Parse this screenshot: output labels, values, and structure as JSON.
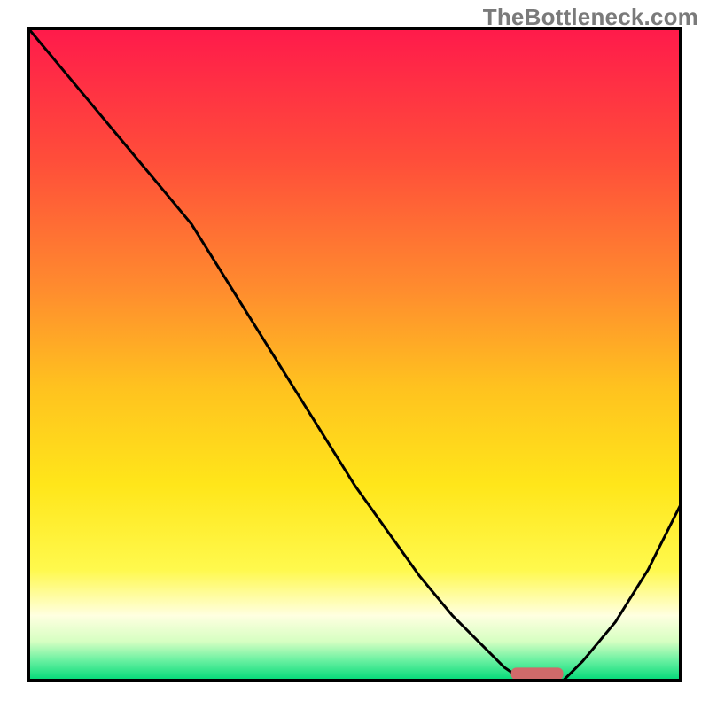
{
  "watermark": "TheBottleneck.com",
  "chart_data": {
    "type": "line",
    "title": "",
    "xlabel": "",
    "ylabel": "",
    "xlim": [
      0,
      100
    ],
    "ylim": [
      0,
      100
    ],
    "grid": false,
    "legend": false,
    "series": [
      {
        "name": "bottleneck-curve",
        "x": [
          0,
          5,
          10,
          15,
          20,
          25,
          30,
          35,
          40,
          45,
          50,
          55,
          60,
          65,
          70,
          73,
          76,
          80,
          82,
          85,
          90,
          95,
          100
        ],
        "y": [
          100,
          94,
          88,
          82,
          76,
          70,
          62,
          54,
          46,
          38,
          30,
          23,
          16,
          10,
          5,
          2,
          0,
          0,
          0,
          3,
          9,
          17,
          27
        ]
      }
    ],
    "optimal_marker": {
      "x_start": 74,
      "x_end": 82,
      "y": 0.5
    },
    "background_gradient": {
      "stops": [
        {
          "pct": 0,
          "color": "#ff1a4b"
        },
        {
          "pct": 20,
          "color": "#ff4d3a"
        },
        {
          "pct": 40,
          "color": "#ff8c2e"
        },
        {
          "pct": 55,
          "color": "#ffc21f"
        },
        {
          "pct": 70,
          "color": "#ffe61a"
        },
        {
          "pct": 83,
          "color": "#fff94d"
        },
        {
          "pct": 90,
          "color": "#ffffe0"
        },
        {
          "pct": 94,
          "color": "#d6ffc2"
        },
        {
          "pct": 97,
          "color": "#66f0a0"
        },
        {
          "pct": 100,
          "color": "#00d977"
        }
      ]
    },
    "frame_color": "#000000",
    "curve_color": "#000000",
    "marker_color": "#d06a6a"
  }
}
